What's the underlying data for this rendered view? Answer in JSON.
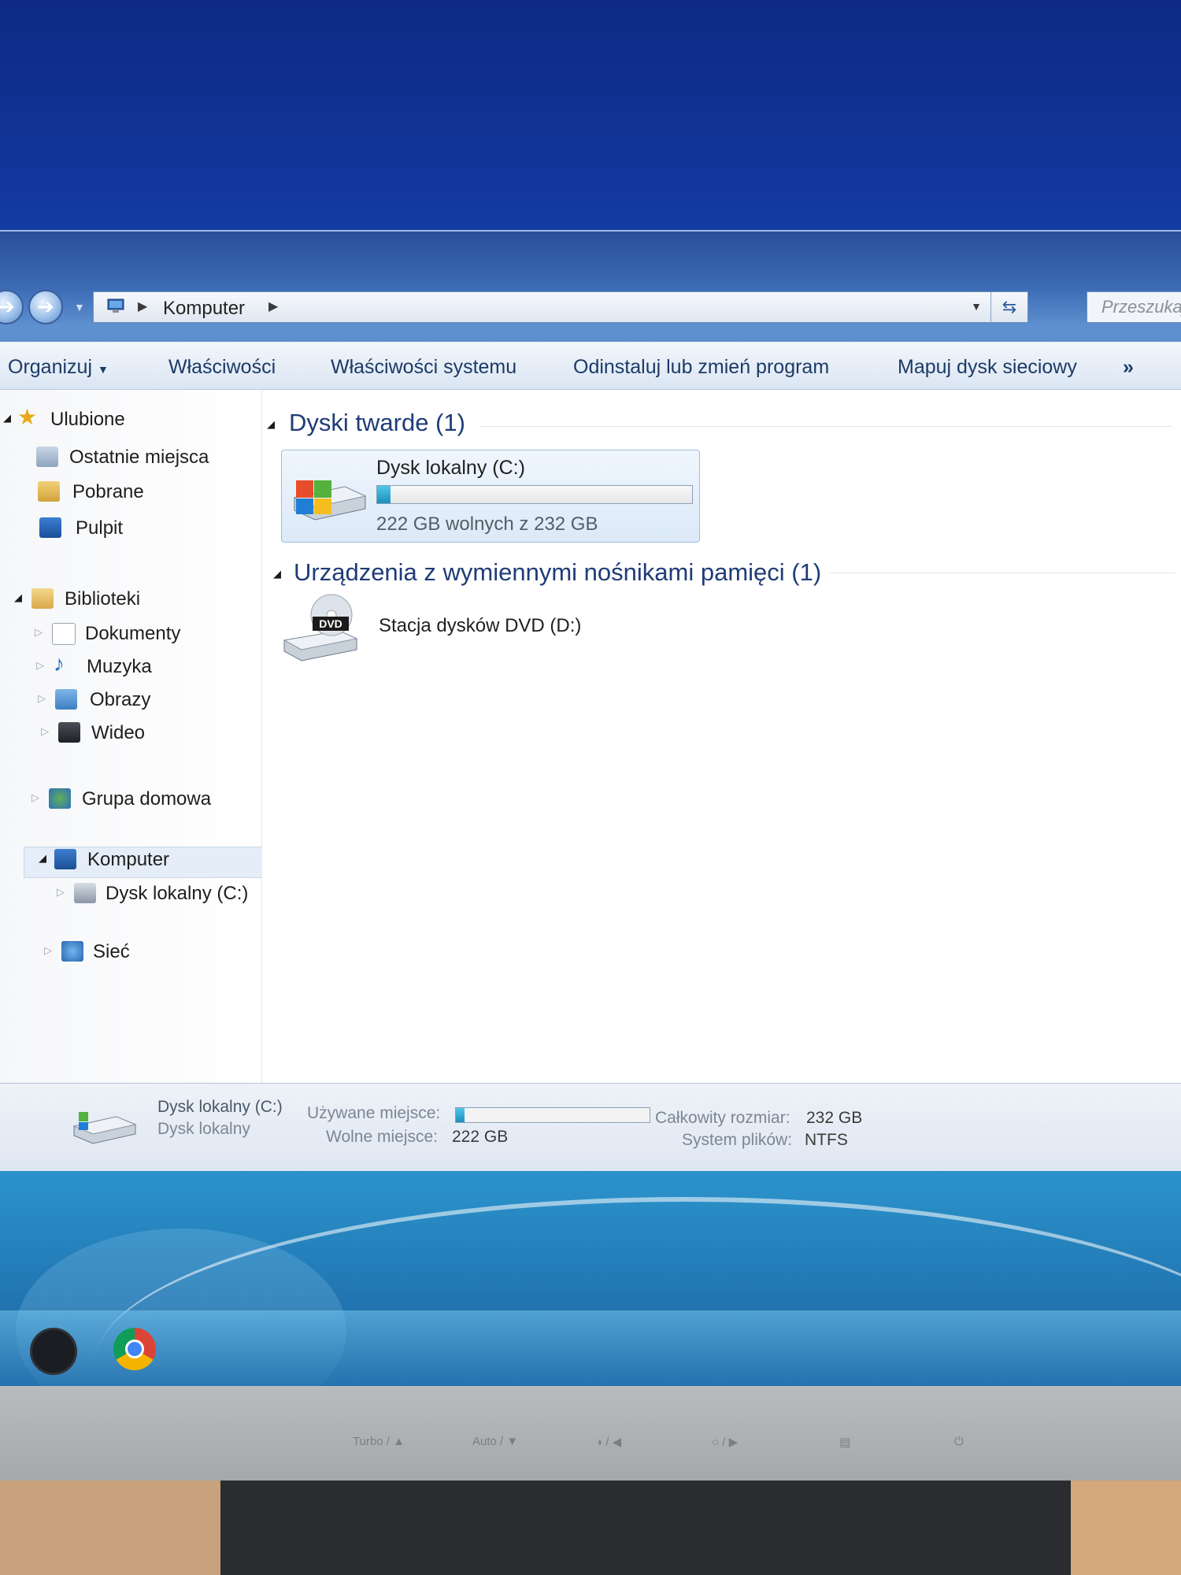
{
  "window": {
    "address": {
      "segments": [
        "Komputer"
      ]
    },
    "search": {
      "placeholder": "Przeszukaj"
    },
    "toolbar": {
      "organize": "Organizuj",
      "properties": "Właściwości",
      "system_properties": "Właściwości systemu",
      "uninstall": "Odinstaluj lub zmień program",
      "map_drive": "Mapuj dysk sieciowy",
      "more": "»"
    },
    "nav_pane": {
      "favorites": {
        "label": "Ulubione",
        "items": [
          "Ostatnie miejsca",
          "Pobrane",
          "Pulpit"
        ]
      },
      "libraries": {
        "label": "Biblioteki",
        "items": [
          "Dokumenty",
          "Muzyka",
          "Obrazy",
          "Wideo"
        ]
      },
      "homegroup": "Grupa domowa",
      "computer": {
        "label": "Komputer",
        "items": [
          "Dysk lokalny (C:)"
        ]
      },
      "network": "Sieć"
    },
    "content": {
      "groups": [
        {
          "title": "Dyski twarde (1)",
          "items": [
            {
              "name": "Dysk lokalny (C:)",
              "free_text": "222 GB wolnych z 232 GB",
              "used_fraction": 0.043,
              "icon": "hard-drive-icon"
            }
          ]
        },
        {
          "title": "Urządzenia z wymiennymi nośnikami pamięci (1)",
          "items": [
            {
              "name": "Stacja dysków DVD (D:)",
              "icon": "dvd-drive-icon",
              "badge": "DVD"
            }
          ]
        }
      ]
    },
    "details": {
      "name": "Dysk lokalny (C:)",
      "type": "Dysk lokalny",
      "used_label": "Używane miejsce:",
      "used_fraction": 0.043,
      "free_label": "Wolne miejsce:",
      "free_value": "222 GB",
      "total_label": "Całkowity rozmiar:",
      "total_value": "232 GB",
      "fs_label": "System plików:",
      "fs_value": "NTFS"
    }
  },
  "bezel_buttons": [
    "Turbo / ▲",
    "Auto / ▼",
    "◑ / ◀",
    "○ / ▶"
  ],
  "colors": {
    "accent": "#1f3c77",
    "usage_bar": "#1d8fbf",
    "desktop_blue": "#12379e"
  }
}
